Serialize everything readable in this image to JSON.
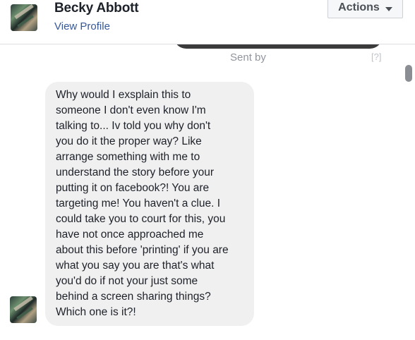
{
  "header": {
    "name": "Becky Abbott",
    "view_profile_label": "View Profile",
    "actions_label": "Actions"
  },
  "thread": {
    "sent_by_label": "Sent by",
    "help_label": "[?]",
    "message": {
      "text": "Why would I exsplain this to\nsomeone I don't even know I'm\ntalking to... Iv told you why don't\nyou do it the proper way? Like\narrange something with me to\nunderstand the story before your\nputting it on facebook?! You are\ntargeting me! You haven't a clue. I\ncould take you to court for this, you\nhave not once approached me\nabout this before 'printing' if you are\nwhat you say you are that's what\nyou'd do if not your just some\nbehind a screen sharing things?\nWhich one is it?!"
    }
  },
  "colors": {
    "link": "#365899",
    "bubble_background": "#f1f0f0",
    "sent_bubble": "#3b3b3b",
    "muted_text": "#90949c"
  }
}
